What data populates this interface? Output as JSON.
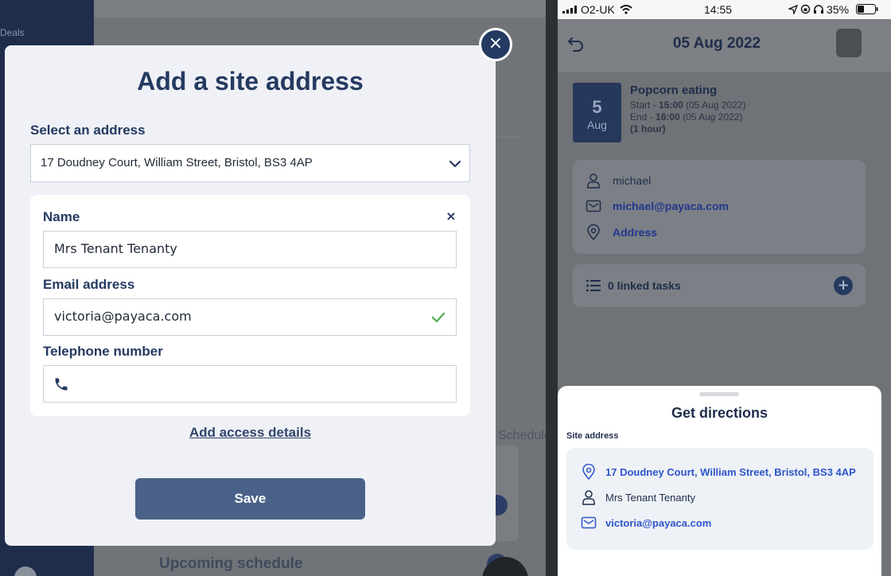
{
  "background_app": {
    "sidebar_label": "Deals",
    "partial_heading": "Schedule",
    "upcoming_heading": "Upcoming schedule"
  },
  "modal": {
    "title": "Add a site address",
    "select_label": "Select an address",
    "selected_address": "17 Doudney Court, William Street, Bristol, BS3 4AP",
    "contact": {
      "name_label": "Name",
      "name_value": "Mrs Tenant Tenanty",
      "email_label": "Email address",
      "email_value": "victoria@payaca.com",
      "phone_label": "Telephone number",
      "phone_value": ""
    },
    "add_access_link": "Add access details",
    "save_label": "Save",
    "close_icon": "×",
    "remove_contact_icon": "×"
  },
  "phone": {
    "status": {
      "carrier": "O2-UK",
      "time": "14:55",
      "battery": "35%"
    },
    "header_date": "05 Aug 2022",
    "event": {
      "day": "5",
      "month": "Aug",
      "title": "Popcorn eating",
      "start_label": "Start - ",
      "start_time": "15:00",
      "start_date": "(05 Aug 2022)",
      "end_label": "End - ",
      "end_time": "16:00",
      "end_date": "(05 Aug 2022)",
      "duration": "(1 hour)"
    },
    "contact": {
      "name": "michael",
      "email": "michael@payaca.com",
      "address_link": "Address"
    },
    "tasks": {
      "label": "0 linked tasks",
      "add_icon": "+"
    },
    "sheet": {
      "title": "Get directions",
      "label": "Site address",
      "address": "17 Doudney Court, William Street, Bristol, BS3 4AP",
      "name": "Mrs Tenant Tenanty",
      "email": "victoria@payaca.com"
    }
  },
  "colors": {
    "navy": "#253a61",
    "save_button": "#4a6288",
    "link_blue": "#2e56c9",
    "check_green": "#4caf50"
  }
}
